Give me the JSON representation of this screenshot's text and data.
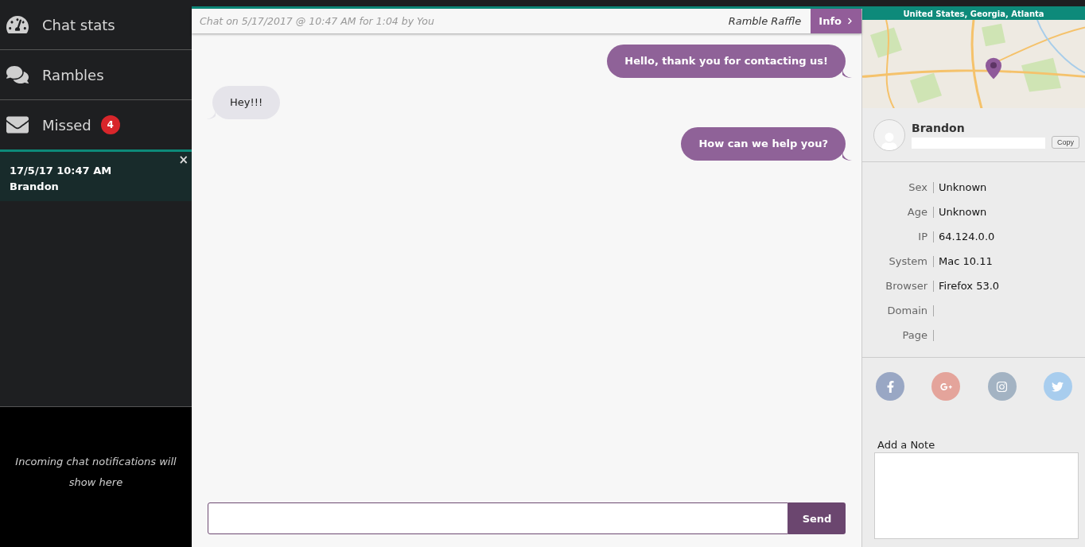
{
  "nav": [
    {
      "kind": "gauge",
      "label": "Chat stats"
    },
    {
      "kind": "chat",
      "label": "Rambles"
    },
    {
      "kind": "mail",
      "label": "Missed",
      "badge": "4"
    }
  ],
  "sessions": [
    {
      "time": "17/5/17 10:47 AM",
      "name": "Brandon",
      "close": "×",
      "selected": true
    }
  ],
  "notifications": {
    "text": "Incoming chat notifications will show here"
  },
  "header": {
    "title": "Chat on 5/17/2017 @ 10:47 AM for 1:04 by You",
    "raffle": "Ramble Raffle",
    "info": "Info"
  },
  "messages": [
    {
      "kind": "outgoing",
      "text": "Hello, thank you for contacting us!"
    },
    {
      "kind": "incoming",
      "text": "Hey!!!"
    },
    {
      "kind": "outgoing",
      "text": "How can we help you?"
    }
  ],
  "composer": {
    "send": "Send"
  },
  "visitor": {
    "location": "United States, Georgia, Atlanta",
    "name": "Brandon",
    "copy": "Copy",
    "fields": [
      {
        "label": "Sex",
        "value": "Unknown"
      },
      {
        "label": "Age",
        "value": "Unknown"
      },
      {
        "label": "IP",
        "value": "64.124.0.0"
      },
      {
        "label": "System",
        "value": "Mac 10.11"
      },
      {
        "label": "Browser",
        "value": "Firefox 53.0"
      },
      {
        "label": "Domain"
      },
      {
        "label": "Page"
      }
    ],
    "social": [
      {
        "kind": "facebook",
        "color": "#99a7c4"
      },
      {
        "kind": "google",
        "color": "#e4a49b"
      },
      {
        "kind": "instagram",
        "color": "#a3b3c3"
      },
      {
        "kind": "twitter",
        "color": "#a8cdee"
      }
    ],
    "note": {
      "label": "Add a Note"
    }
  }
}
